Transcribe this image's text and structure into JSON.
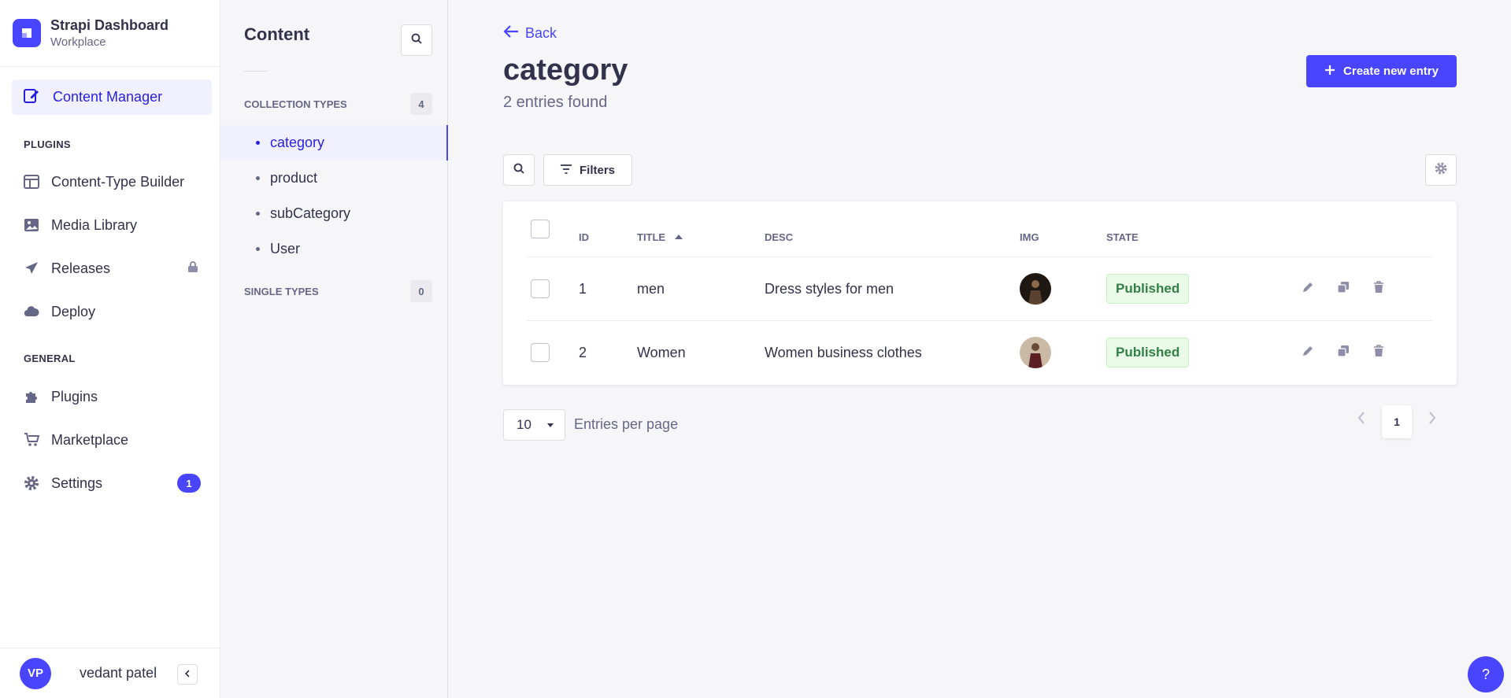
{
  "brand": {
    "title": "Strapi Dashboard",
    "subtitle": "Workplace"
  },
  "nav": {
    "active_label": "Content Manager",
    "plugins_heading": "PLUGINS",
    "plugins": [
      {
        "label": "Content-Type Builder",
        "icon": "layout-icon"
      },
      {
        "label": "Media Library",
        "icon": "image-icon"
      },
      {
        "label": "Releases",
        "icon": "paper-plane-icon",
        "locked": true
      },
      {
        "label": "Deploy",
        "icon": "cloud-icon"
      }
    ],
    "general_heading": "GENERAL",
    "general": [
      {
        "label": "Plugins",
        "icon": "puzzle-icon"
      },
      {
        "label": "Marketplace",
        "icon": "cart-icon"
      },
      {
        "label": "Settings",
        "icon": "gear-icon",
        "badge": "1"
      }
    ]
  },
  "user": {
    "initials": "VP",
    "name": "vedant patel"
  },
  "subnav": {
    "title": "Content",
    "collection_heading": "COLLECTION TYPES",
    "collection_count": "4",
    "items": [
      "category",
      "product",
      "subCategory",
      "User"
    ],
    "active_item": "category",
    "single_heading": "SINGLE TYPES",
    "single_count": "0"
  },
  "header": {
    "back_label": "Back",
    "title": "category",
    "subtitle": "2 entries found",
    "create_label": "Create new entry"
  },
  "toolbar": {
    "filters_label": "Filters"
  },
  "table": {
    "columns": {
      "id": "ID",
      "title": "TITLE",
      "desc": "DESC",
      "img": "IMG",
      "state": "STATE"
    },
    "sort": {
      "column": "TITLE",
      "direction": "ascending"
    },
    "rows": [
      {
        "id": "1",
        "title": "men",
        "desc": "Dress styles for men",
        "state": "Published"
      },
      {
        "id": "2",
        "title": "Women",
        "desc": "Women business clothes",
        "state": "Published"
      }
    ]
  },
  "pagination": {
    "per_page": "10",
    "per_page_label": "Entries per page",
    "current_page": "1"
  },
  "help_label": "?",
  "colors": {
    "primary": "#4945ff",
    "active_text": "#271fe0",
    "success_text": "#328048",
    "success_bg": "#eafbe7"
  }
}
